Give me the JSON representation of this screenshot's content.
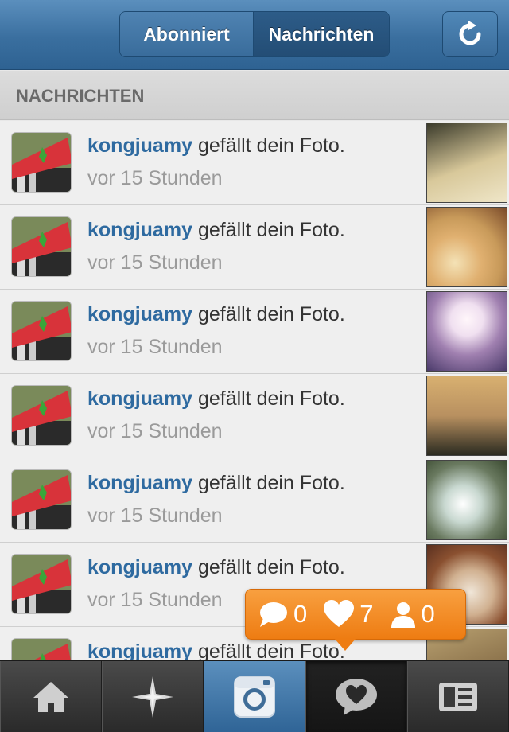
{
  "header": {
    "tabs": [
      {
        "label": "Abonniert",
        "selected": false
      },
      {
        "label": "Nachrichten",
        "selected": true
      }
    ],
    "refresh_icon": "refresh-icon"
  },
  "section": {
    "title": "NACHRICHTEN"
  },
  "items": [
    {
      "user": "kongjuamy",
      "action": "gefällt dein Foto.",
      "time": "vor 15 Stunden",
      "thumb_colors": [
        "#3a3a2a",
        "#d8c89a"
      ]
    },
    {
      "user": "kongjuamy",
      "action": "gefällt dein Foto.",
      "time": "vor 15 Stunden",
      "thumb_colors": [
        "#c89a5a",
        "#f4e2b6"
      ]
    },
    {
      "user": "kongjuamy",
      "action": "gefällt dein Foto.",
      "time": "vor 15 Stunden",
      "thumb_colors": [
        "#4a3a6a",
        "#f0e0f0"
      ]
    },
    {
      "user": "kongjuamy",
      "action": "gefällt dein Foto.",
      "time": "vor 15 Stunden",
      "thumb_colors": [
        "#2a2a20",
        "#d8b070"
      ]
    },
    {
      "user": "kongjuamy",
      "action": "gefällt dein Foto.",
      "time": "vor 15 Stunden",
      "thumb_colors": [
        "#3a4a30",
        "#c8d8d0"
      ]
    },
    {
      "user": "kongjuamy",
      "action": "gefällt dein Foto.",
      "time": "vor 15 Stunden",
      "thumb_colors": [
        "#5a3020",
        "#f0e6d8"
      ]
    },
    {
      "user": "kongjuamy",
      "action": "gefällt dein Foto.",
      "time": "",
      "thumb_colors": [
        "#6a5030",
        "#b8a070"
      ]
    }
  ],
  "notification": {
    "comments": "0",
    "likes": "7",
    "followers": "0"
  },
  "tabbar": {
    "items": [
      "home-icon",
      "explore-icon",
      "camera-icon",
      "news-icon",
      "profile-icon"
    ],
    "active": "news-icon"
  },
  "colors": {
    "header": "#3a6f9f",
    "username": "#2e6aa0",
    "bubble": "#ee7c12"
  }
}
